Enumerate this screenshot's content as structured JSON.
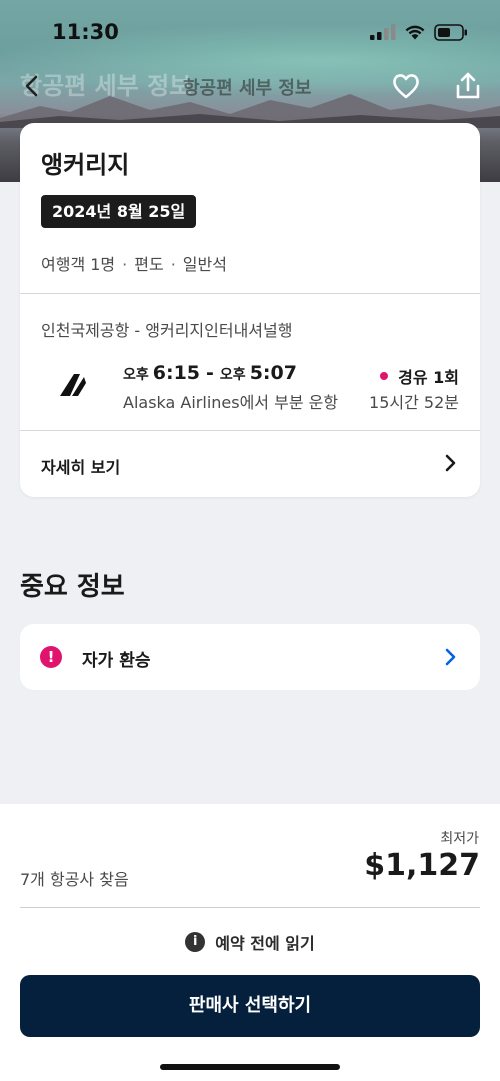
{
  "status_bar": {
    "time": "11:30"
  },
  "nav": {
    "large_title": "항공편 세부 정보",
    "title": "항공편 세부 정보",
    "icons": [
      "back-arrow-icon",
      "heart-icon",
      "share-icon"
    ]
  },
  "flight_card": {
    "city": "앵커리지",
    "date": "2024년 8월 25일",
    "meta": [
      "여행객 1명",
      "편도",
      "일반석"
    ],
    "route": "인천국제공항 - 앵커리지인터내셔널행",
    "departure_ampm": "오후",
    "departure_time": "6:15",
    "arrival_ampm": "오후",
    "arrival_time": "5:07",
    "operator": "Alaska Airlines에서 부분 운항",
    "stops": "경유 1회",
    "duration": "15시간 52분",
    "details_label": "자세히 보기"
  },
  "important": {
    "section_title": "중요 정보",
    "item_label": "자가 환승"
  },
  "bottom": {
    "lowest_label": "최저가",
    "carriers": "7개 항공사 찾음",
    "price": "$1,127",
    "read_before": "예약 전에 읽기",
    "cta": "판매사 선택하기"
  },
  "colors": {
    "accent_pink": "#e0146e",
    "cta_navy": "#05203c",
    "link_blue": "#0062e3"
  }
}
